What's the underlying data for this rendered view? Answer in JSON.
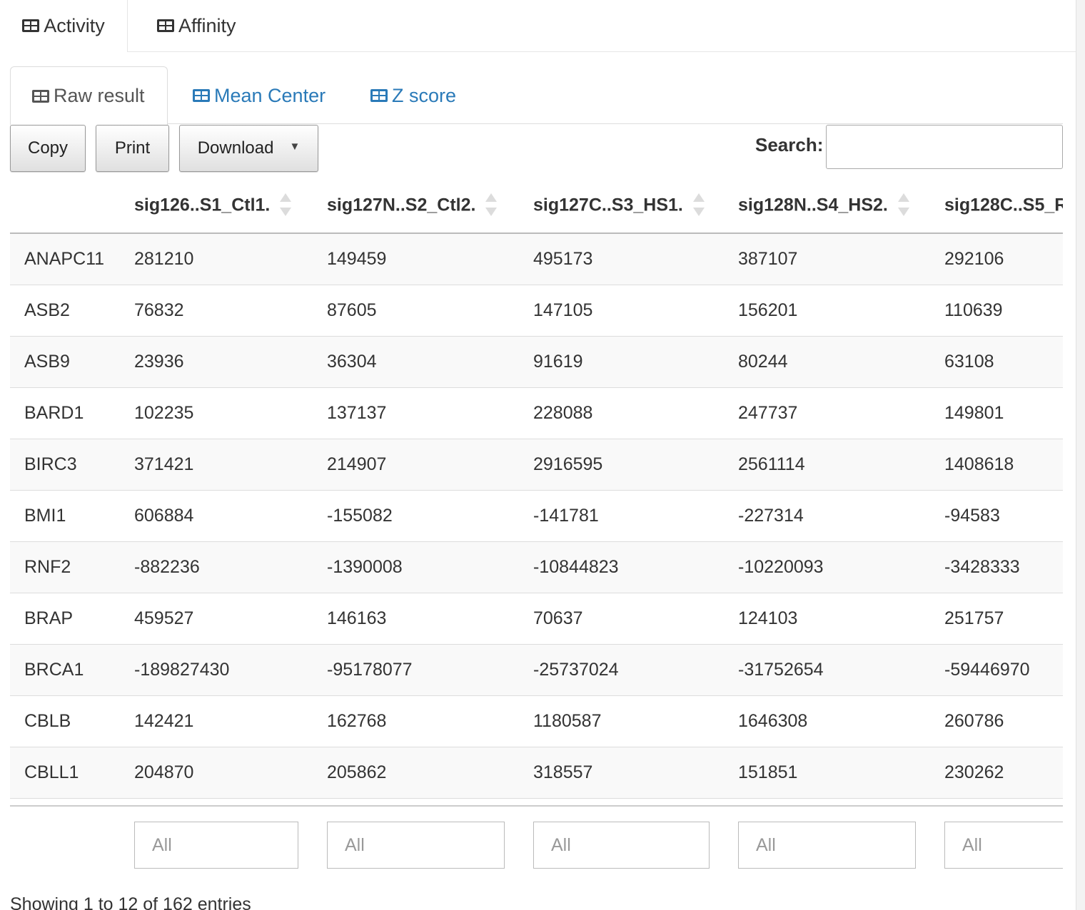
{
  "top_tabs": [
    {
      "label": "Activity",
      "icon": "table-icon",
      "active": true
    },
    {
      "label": "Affinity",
      "icon": "table-icon",
      "active": false
    }
  ],
  "sub_tabs": [
    {
      "label": "Raw result",
      "icon": "table-icon",
      "active": true
    },
    {
      "label": "Mean Center",
      "icon": "table-icon",
      "active": false
    },
    {
      "label": "Z score",
      "icon": "table-icon",
      "active": false
    }
  ],
  "toolbar": {
    "copy_label": "Copy",
    "print_label": "Print",
    "download_label": "Download",
    "download_caret": "▼",
    "search_label": "Search:",
    "search_value": ""
  },
  "table": {
    "columns": [
      "",
      "sig126..S1_Ctl1.",
      "sig127N..S2_Ctl2.",
      "sig127C..S3_HS1.",
      "sig128N..S4_HS2.",
      "sig128C..S5_R"
    ],
    "rows": [
      [
        "ANAPC11",
        "281210",
        "149459",
        "495173",
        "387107",
        "292106"
      ],
      [
        "ASB2",
        "76832",
        "87605",
        "147105",
        "156201",
        "110639"
      ],
      [
        "ASB9",
        "23936",
        "36304",
        "91619",
        "80244",
        "63108"
      ],
      [
        "BARD1",
        "102235",
        "137137",
        "228088",
        "247737",
        "149801"
      ],
      [
        "BIRC3",
        "371421",
        "214907",
        "2916595",
        "2561114",
        "1408618"
      ],
      [
        "BMI1",
        "606884",
        "-155082",
        "-141781",
        "-227314",
        "-94583"
      ],
      [
        "RNF2",
        "-882236",
        "-1390008",
        "-10844823",
        "-10220093",
        "-3428333"
      ],
      [
        "BRAP",
        "459527",
        "146163",
        "70637",
        "124103",
        "251757"
      ],
      [
        "BRCA1",
        "-189827430",
        "-95178077",
        "-25737024",
        "-31752654",
        "-59446970"
      ],
      [
        "CBLB",
        "142421",
        "162768",
        "1180587",
        "1646308",
        "260786"
      ],
      [
        "CBLL1",
        "204870",
        "205862",
        "318557",
        "151851",
        "230262"
      ]
    ],
    "filter_placeholder": "All"
  },
  "info_text": "Showing 1 to 12 of 162 entries",
  "colors": {
    "link": "#2a7ab8",
    "stripe": "#f9f9f9"
  }
}
